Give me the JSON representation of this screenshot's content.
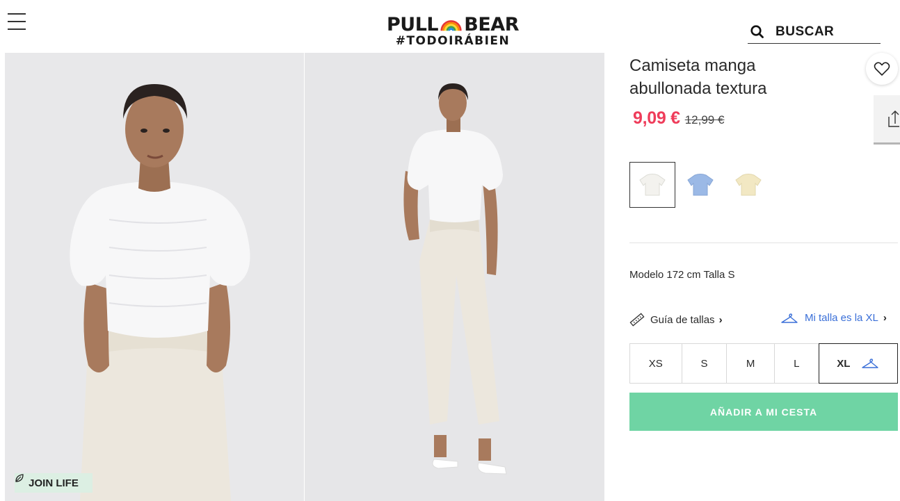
{
  "header": {
    "brand_left": "PULL",
    "brand_right": "BEAR",
    "brand_tag": "#TODOIRÁBIEN",
    "search_label": "BUSCAR"
  },
  "gallery": {
    "badge_label": "JOIN LIFE"
  },
  "product": {
    "title_line1": "Camiseta manga",
    "title_line2": "abullonada textura",
    "price_now": "9,09 €",
    "price_old": "12,99 €",
    "price_color": "#ef3c5a",
    "colors": [
      {
        "name": "blanco",
        "hex": "#f3f2ee",
        "selected": true
      },
      {
        "name": "azul",
        "hex": "#9bb9e6",
        "selected": false
      },
      {
        "name": "amarillo",
        "hex": "#f2e8c3",
        "selected": false
      }
    ],
    "model_info": "Modelo 172 cm Talla S",
    "size_guide_label": "Guía de tallas",
    "my_size_label": "Mi talla es la XL",
    "sizes": [
      "XS",
      "S",
      "M",
      "L",
      "XL"
    ],
    "selected_size": "XL",
    "add_to_cart_label": "AÑADIR A MI CESTA",
    "cta_color": "#6fd4a4"
  }
}
